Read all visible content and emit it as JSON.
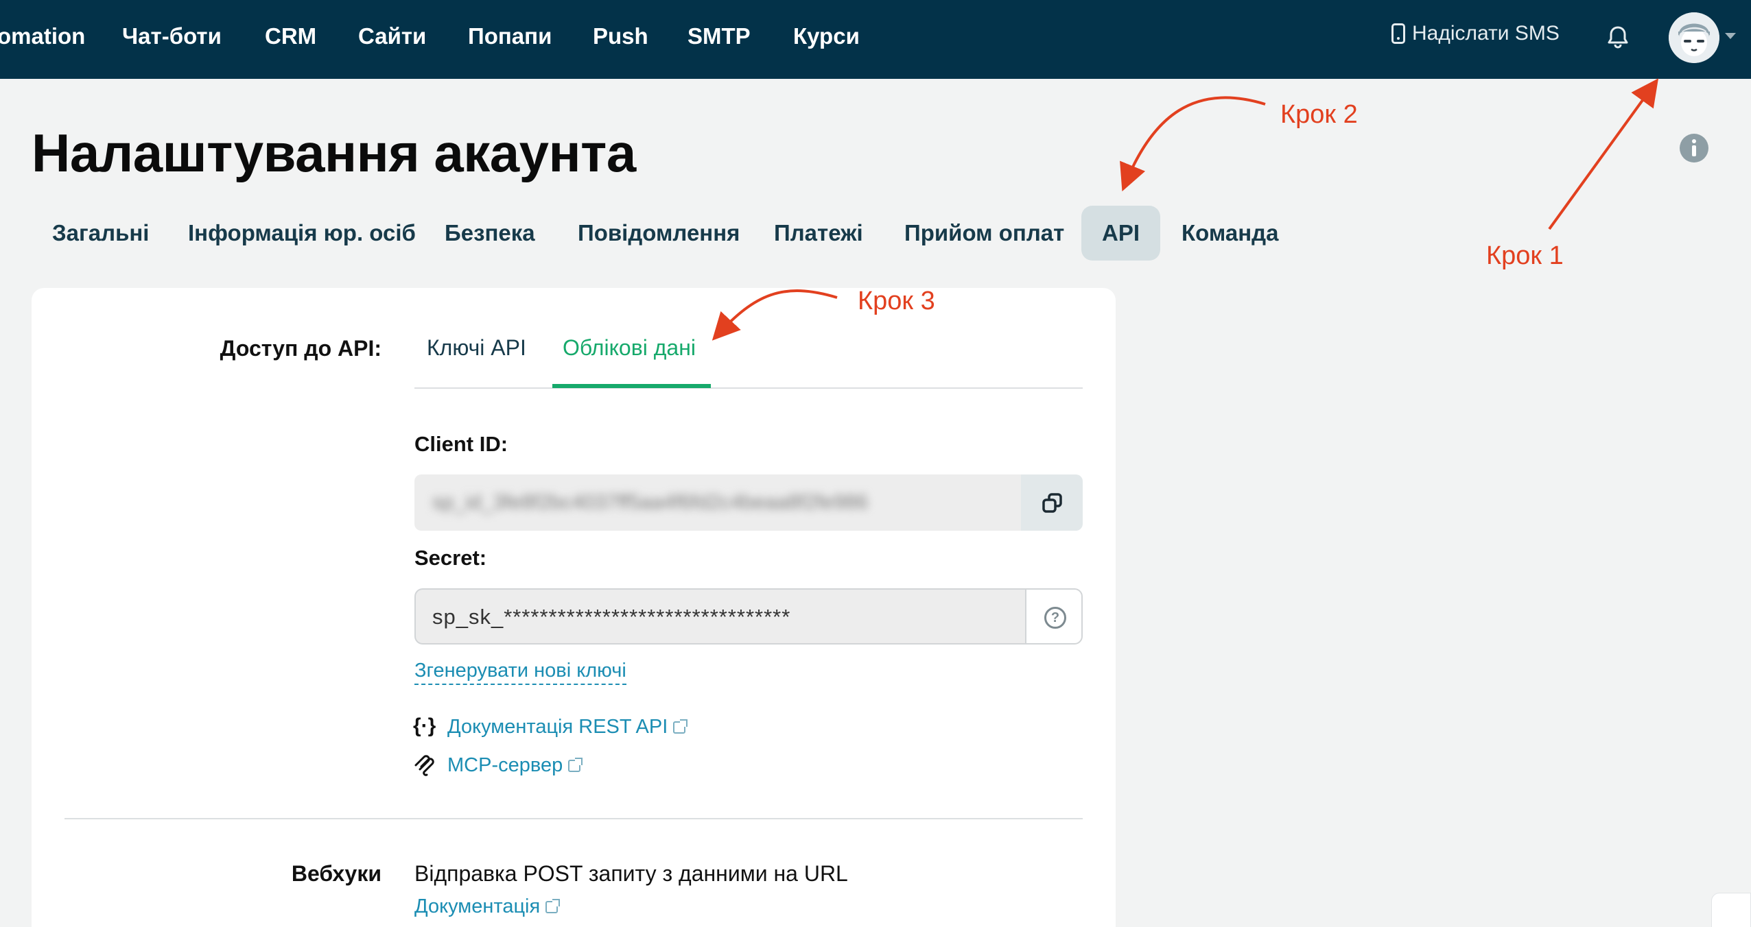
{
  "topnav": {
    "items": [
      "omation",
      "Чат-боти",
      "CRM",
      "Сайти",
      "Попапи",
      "Push",
      "SMTP",
      "Курси"
    ],
    "sms_label": "Надіслати SMS"
  },
  "page": {
    "title": "Налаштування акаунта"
  },
  "tabs": [
    "Загальні",
    "Інформація юр. осіб",
    "Безпека",
    "Повідомлення",
    "Платежі",
    "Прийом оплат",
    "API",
    "Команда"
  ],
  "api_section": {
    "label": "Доступ до API:",
    "subtabs": [
      "Ключі API",
      "Облікові дані"
    ],
    "active_subtab": "Облікові дані",
    "client_id_label": "Client ID:",
    "client_id_value": "sp_id_3fe8f2bc4037ff5aa4f6fd2c4beaa8f2fe986",
    "secret_label": "Secret:",
    "secret_value": "sp_sk_********************************",
    "regenerate_link": "Згенерувати нові ключі",
    "docs_rest_link": "Документація REST API",
    "mcp_link": "MCP-сервер",
    "rest_glyph": "{·}"
  },
  "webhooks": {
    "label": "Вебхуки",
    "description": "Відправка POST запиту з данними на URL",
    "docs_link": "Документація"
  },
  "annotations": {
    "step1": "Крок 1",
    "step2": "Крок 2",
    "step3": "Крок 3",
    "color": "#e2401f"
  },
  "colors": {
    "topbar": "#033249",
    "accent_green": "#16a96b",
    "link_blue": "#1b8db3",
    "active_tab_bg": "#d5dfe2"
  }
}
